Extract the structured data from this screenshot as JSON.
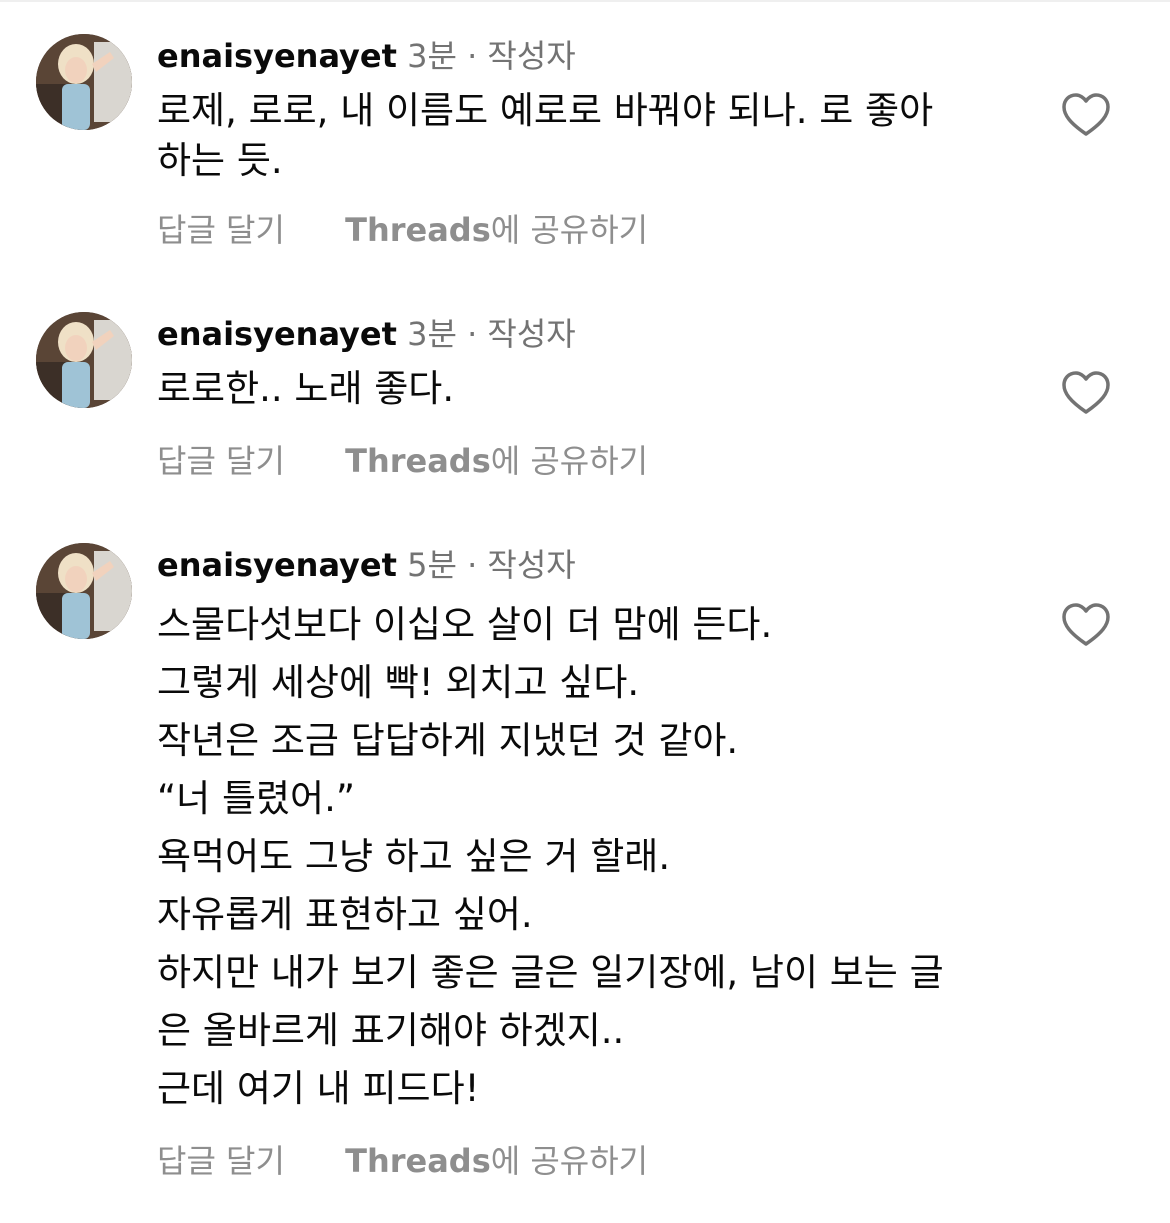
{
  "comments": [
    {
      "username": "enaisyenayet",
      "time": "3분",
      "separator": "·",
      "author_tag": "작성자",
      "text": "로제, 로로, 내 이름도 예로로 바꿔야 되나. 로 좋아\n하는 듯.",
      "reply_label": "답글 달기",
      "share_brand": "Threads",
      "share_suffix": "에 공유하기",
      "like_icon": "heart-outline-icon"
    },
    {
      "username": "enaisyenayet",
      "time": "3분",
      "separator": "·",
      "author_tag": "작성자",
      "text": "로로한.. 노래 좋다.",
      "reply_label": "답글 달기",
      "share_brand": "Threads",
      "share_suffix": "에 공유하기",
      "like_icon": "heart-outline-icon"
    },
    {
      "username": "enaisyenayet",
      "time": "5분",
      "separator": "·",
      "author_tag": "작성자",
      "text": "스물다섯보다 이십오 살이 더 맘에 든다.\n그렇게 세상에 빡! 외치고 싶다.\n작년은 조금 답답하게 지냈던 것 같아.\n“너 틀렸어.”\n욕먹어도 그냥 하고 싶은 거 할래.\n자유롭게 표현하고 싶어.\n하지만 내가 보기 좋은 글은 일기장에, 남이 보는 글\n은 올바르게 표기해야 하겠지..\n근데 여기 내 피드다!",
      "reply_label": "답글 달기",
      "share_brand": "Threads",
      "share_suffix": "에 공유하기",
      "like_icon": "heart-outline-icon"
    }
  ],
  "colors": {
    "primary_text": "#0a0a0a",
    "secondary_text": "#737373",
    "action_text": "#8e8e8e",
    "icon_stroke": "#737373",
    "background": "#ffffff"
  }
}
